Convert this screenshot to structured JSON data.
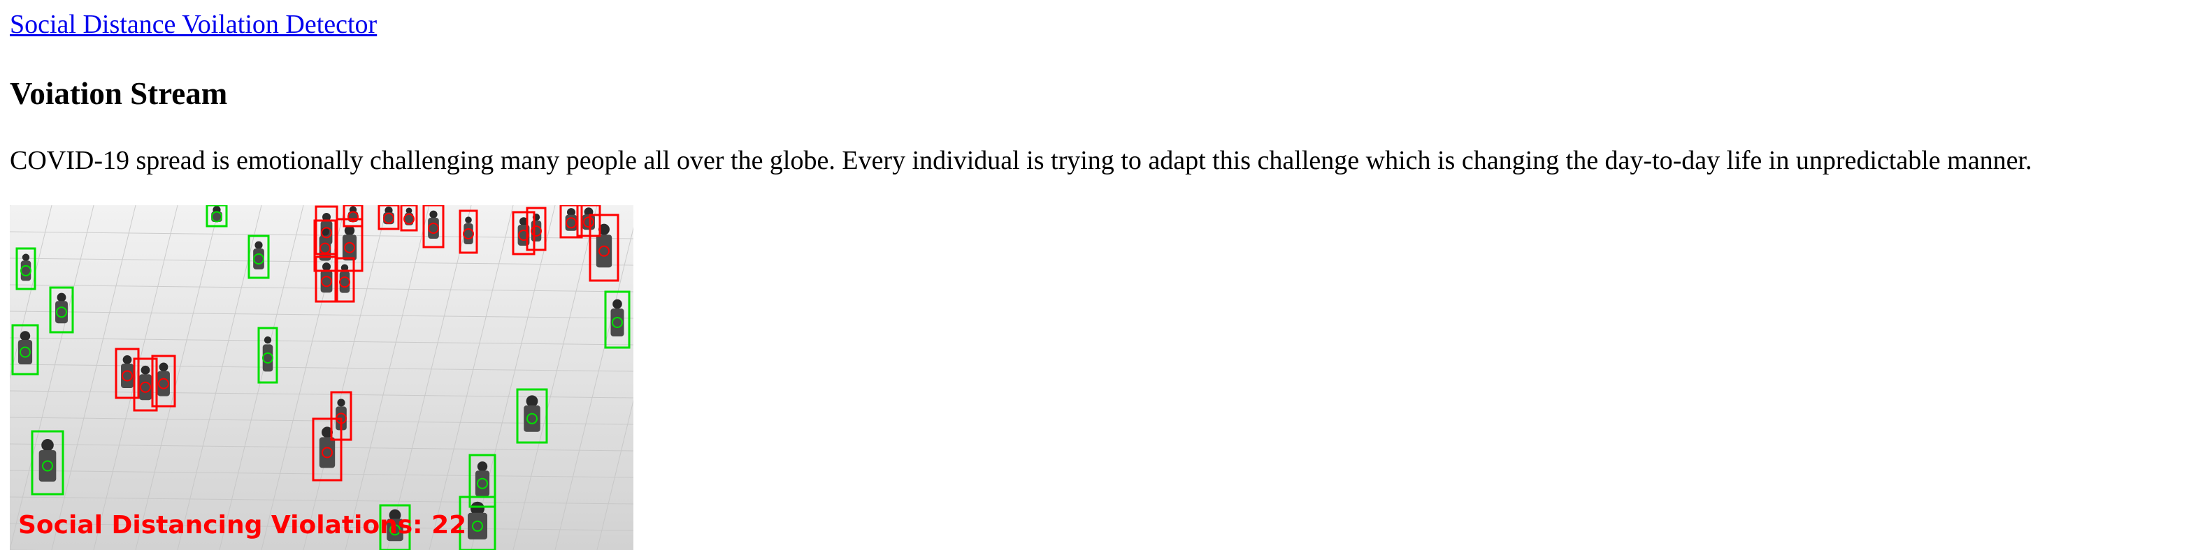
{
  "header": {
    "brand_link": "Social Distance Voilation Detector"
  },
  "main": {
    "title": "Voiation Stream",
    "description": "COVID-19 spread is emotionally challenging many people all over the globe. Every individual is trying to adapt this challenge which is changing the day-to-day life in unpredictable manner."
  },
  "stream": {
    "overlay_label": "Social Distancing Violations: 22",
    "colors": {
      "violation_box": "#ff0000",
      "safe_box": "#00e000",
      "floor": "#d8d8d8",
      "overlay_text": "#ff0000"
    }
  }
}
